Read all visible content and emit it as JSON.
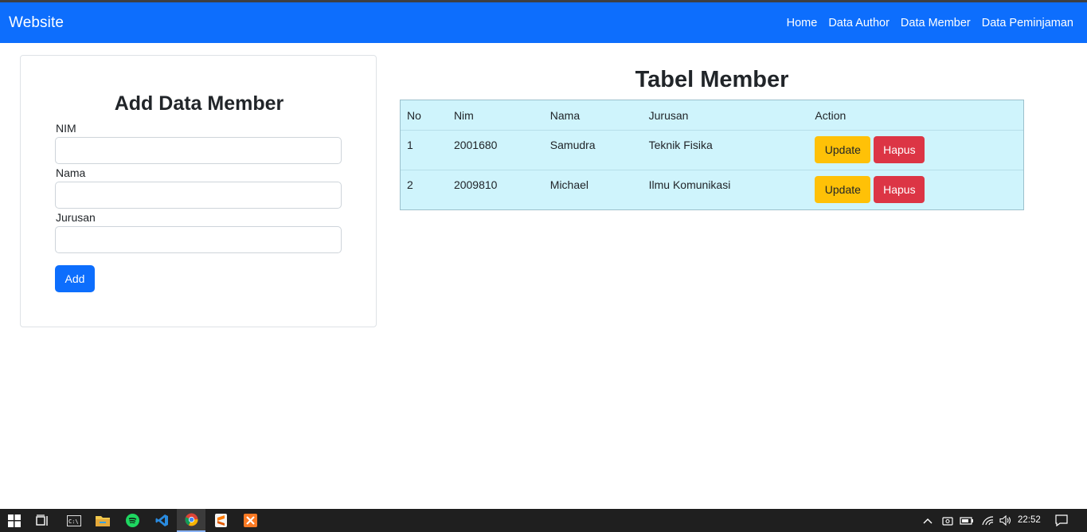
{
  "navbar": {
    "brand": "Website",
    "links": [
      "Home",
      "Data Author",
      "Data Member",
      "Data Peminjaman"
    ]
  },
  "form": {
    "title": "Add Data Member",
    "fields": [
      {
        "label": "NIM",
        "value": "",
        "placeholder": ""
      },
      {
        "label": "Nama",
        "value": "",
        "placeholder": ""
      },
      {
        "label": "Jurusan",
        "value": "",
        "placeholder": ""
      }
    ],
    "submit_label": "Add"
  },
  "table": {
    "title": "Tabel Member",
    "headers": [
      "No",
      "Nim",
      "Nama",
      "Jurusan",
      "Action"
    ],
    "rows": [
      {
        "no": "1",
        "nim": "2001680",
        "nama": "Samudra",
        "jurusan": "Teknik Fisika",
        "update_label": "Update",
        "delete_label": "Hapus"
      },
      {
        "no": "2",
        "nim": "2009810",
        "nama": "Michael",
        "jurusan": "Ilmu Komunikasi",
        "update_label": "Update",
        "delete_label": "Hapus"
      }
    ]
  },
  "taskbar": {
    "apps": [
      "windows-start-icon",
      "task-view-icon",
      "terminal-icon",
      "file-explorer-icon",
      "spotify-icon",
      "vscode-icon",
      "chrome-icon",
      "sublime-icon",
      "xampp-icon"
    ],
    "active_app": "chrome-icon",
    "clock": "22:52"
  },
  "colors": {
    "primary": "#0d6efd",
    "warning": "#ffc107",
    "danger": "#dc3545",
    "table_bg": "#cff4fc"
  }
}
